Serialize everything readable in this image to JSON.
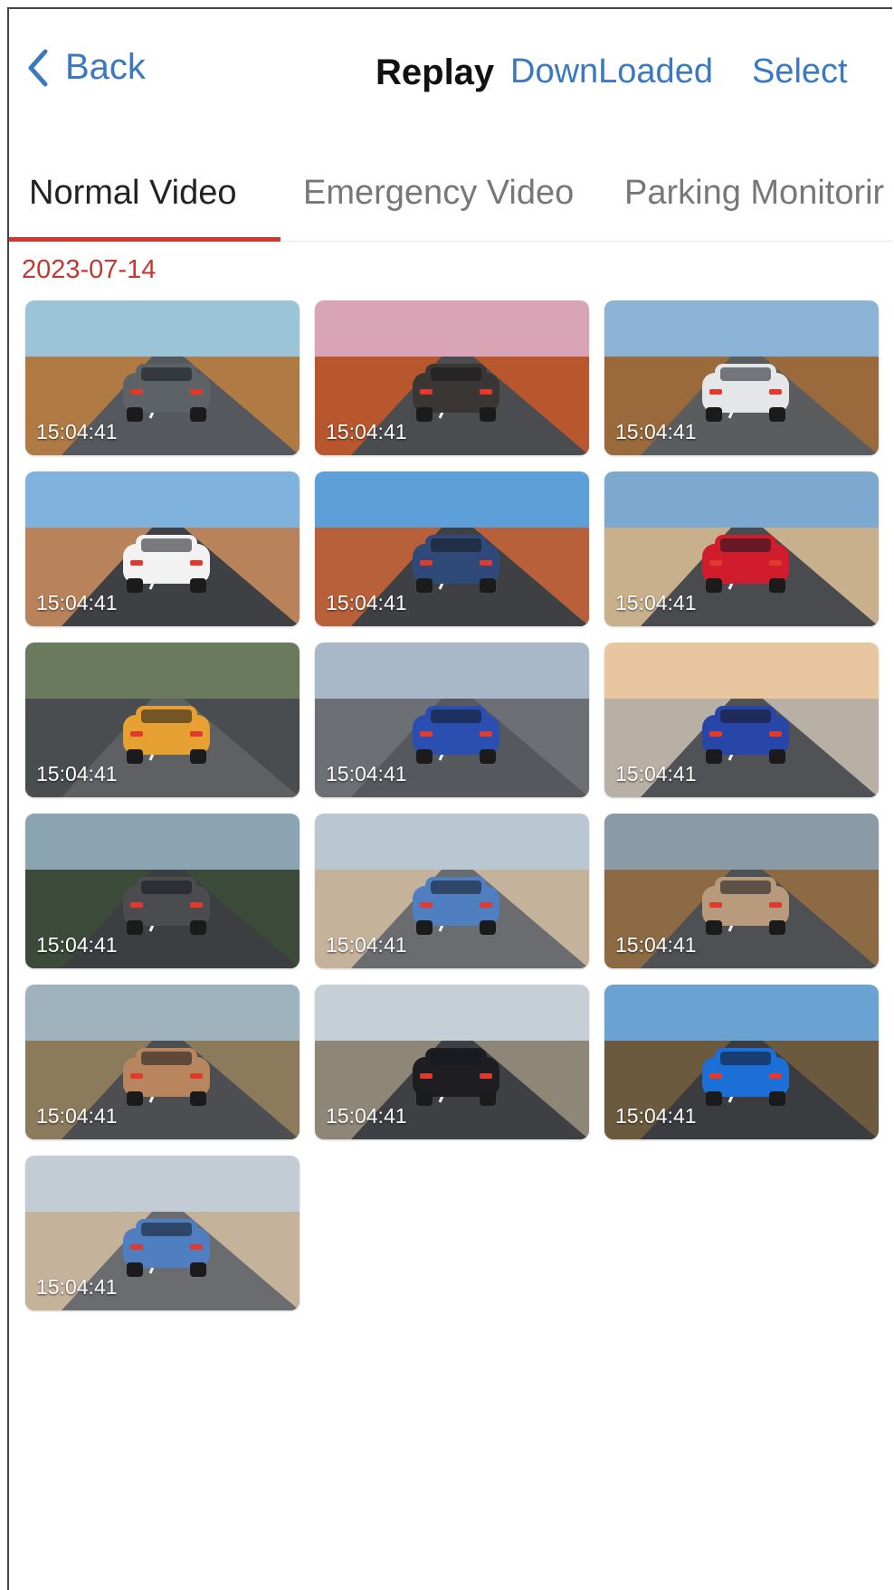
{
  "header": {
    "back_label": "Back",
    "title": "Replay",
    "downloaded_label": "DownLoaded",
    "select_label": "Select"
  },
  "tabs": [
    {
      "label": "Normal Video",
      "active": true
    },
    {
      "label": "Emergency Video",
      "active": false
    },
    {
      "label": "Parking Monitorir",
      "active": false
    }
  ],
  "colors": {
    "accent_blue": "#3b78c2",
    "accent_red": "#d3382f",
    "date_red": "#c4382f"
  },
  "groups": [
    {
      "date": "2023-07-14",
      "videos": [
        {
          "time": "15:04:41",
          "sky": "#9cc4d8",
          "ground": "#b07a44",
          "road": "#55585c",
          "car": "#5c6266"
        },
        {
          "time": "15:04:41",
          "sky": "#d9a4b6",
          "ground": "#b8562e",
          "road": "#4a4c50",
          "car": "#3a3634"
        },
        {
          "time": "15:04:41",
          "sky": "#8ab3d6",
          "ground": "#9a6a3c",
          "road": "#5a5c5e",
          "car": "#e4e6e8"
        },
        {
          "time": "15:04:41",
          "sky": "#7fb2dd",
          "ground": "#b8825a",
          "road": "#3e4044",
          "car": "#f2f2f2"
        },
        {
          "time": "15:04:41",
          "sky": "#5d9fd8",
          "ground": "#b8603a",
          "road": "#3e4044",
          "car": "#2f4a78"
        },
        {
          "time": "15:04:41",
          "sky": "#7da8cf",
          "ground": "#c9b08c",
          "road": "#494b4f",
          "car": "#d01c2c"
        },
        {
          "time": "15:04:41",
          "sky": "#6b7a5c",
          "ground": "#4a4d50",
          "road": "#5e6064",
          "car": "#e6a132"
        },
        {
          "time": "15:04:41",
          "sky": "#a8b8c8",
          "ground": "#6c6f74",
          "road": "#55585c",
          "car": "#2a4fb0"
        },
        {
          "time": "15:04:41",
          "sky": "#e8c7a0",
          "ground": "#b8b0a4",
          "road": "#505256",
          "car": "#2846a8"
        },
        {
          "time": "15:04:41",
          "sky": "#8aa4b2",
          "ground": "#3c4a3a",
          "road": "#3c3e42",
          "car": "#4a4c50"
        },
        {
          "time": "15:04:41",
          "sky": "#b9c7d2",
          "ground": "#c4b29a",
          "road": "#6a6c70",
          "car": "#4f7fc0"
        },
        {
          "time": "15:04:41",
          "sky": "#8a9aa6",
          "ground": "#8b6a44",
          "road": "#4e5054",
          "car": "#b89a7c"
        },
        {
          "time": "15:04:41",
          "sky": "#9eb2be",
          "ground": "#8c7a5c",
          "road": "#4c4e52",
          "car": "#b8865e"
        },
        {
          "time": "15:04:41",
          "sky": "#c6cfd6",
          "ground": "#8e8676",
          "road": "#3e4044",
          "car": "#1e1e22"
        },
        {
          "time": "15:04:41",
          "sky": "#6aa2d2",
          "ground": "#6c5a3e",
          "road": "#3a3c40",
          "car": "#1d6fd8"
        },
        {
          "time": "15:04:41",
          "sky": "#c3ccd4",
          "ground": "#c4b29a",
          "road": "#6a6c70",
          "car": "#4f7fc0"
        }
      ]
    }
  ]
}
